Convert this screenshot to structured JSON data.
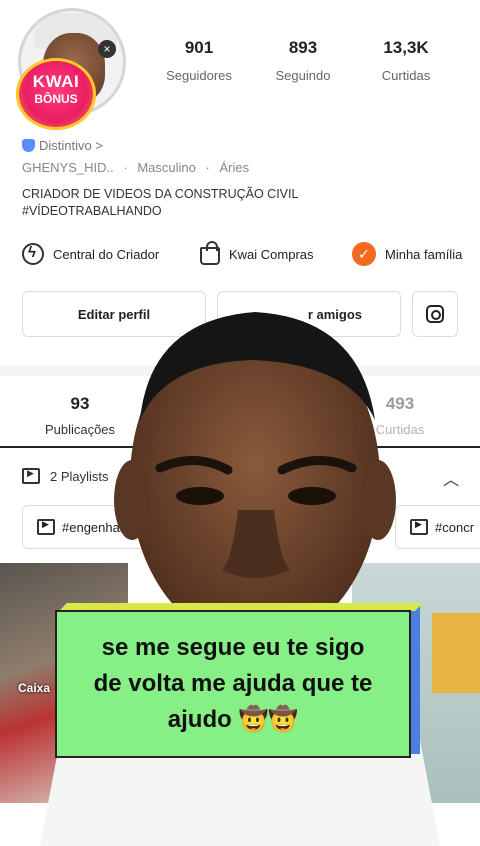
{
  "profile": {
    "badge": {
      "line1": "KWAI",
      "line2": "BÔNUS"
    },
    "stats": [
      {
        "value": "901",
        "label": "Seguidores"
      },
      {
        "value": "893",
        "label": "Seguindo"
      },
      {
        "value": "13,3K",
        "label": "Curtidas"
      }
    ],
    "distintivo": "Distintivo >",
    "username": "GHENYS_HID..",
    "gender": "Masculino",
    "sign": "Áries",
    "bio_line1": "CRIADOR DE VIDEOS DA CONSTRUÇÃO CIVIL",
    "bio_line2": "#VÍDEOTRABALHANDO"
  },
  "quick_links": [
    {
      "label": "Central do Criador",
      "icon": "bolt-icon"
    },
    {
      "label": "Kwai Compras",
      "icon": "shopping-bag-icon"
    },
    {
      "label": "Minha família",
      "icon": "check-circle-icon"
    }
  ],
  "buttons": {
    "edit_profile": "Editar perfil",
    "add_friends_visible": "r amigos",
    "instagram": "instagram-icon"
  },
  "tabs": [
    {
      "count": "93",
      "label": "Publicações"
    },
    {
      "count": "493",
      "label": "Curtidas"
    }
  ],
  "playlists": {
    "label": "2 Playlists",
    "chips": [
      "#engenhari",
      "#concr"
    ]
  },
  "thumbnail": {
    "text_visible": "Caixa"
  },
  "caption": {
    "line1": "se me segue eu te sigo",
    "line2": "de volta me ajuda que te",
    "line3": "ajudo 🤠🤠"
  },
  "colors": {
    "caption_bg": "#86ef86",
    "caption_shadow": "#4d7fe0",
    "accent_orange": "#f26b21",
    "kwai_pink": "#e91e63"
  }
}
